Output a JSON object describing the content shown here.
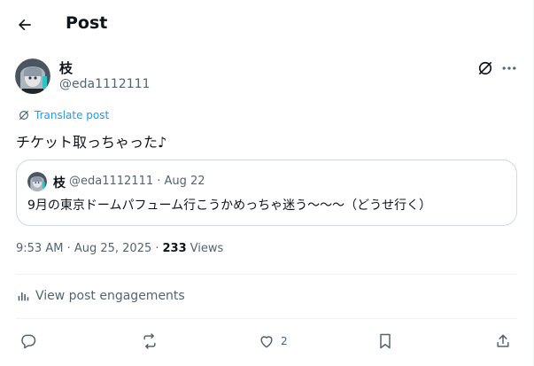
{
  "header": {
    "title": "Post",
    "back_icon": "arrow-left-icon"
  },
  "author": {
    "display_name": "枝",
    "handle": "@eda1112111"
  },
  "translate_label": "Translate post",
  "post_text": "チケット取っちゃった♪",
  "quote": {
    "display_name": "枝",
    "meta": "@eda1112111 · Aug 22",
    "text": "9月の東京ドームパフューム行こうかめっちゃ迷う〜〜〜（どうせ行く）"
  },
  "meta": {
    "time": "9:53 AM · Aug 25, 2025 ·",
    "views_count": "233",
    "views_label": "Views"
  },
  "engagements_label": "View post engagements",
  "actions": {
    "like_count": "2"
  },
  "colors": {
    "accent": "#1d9bf0",
    "text": "#0f1419",
    "muted": "#536471",
    "border": "#cfd9de"
  }
}
